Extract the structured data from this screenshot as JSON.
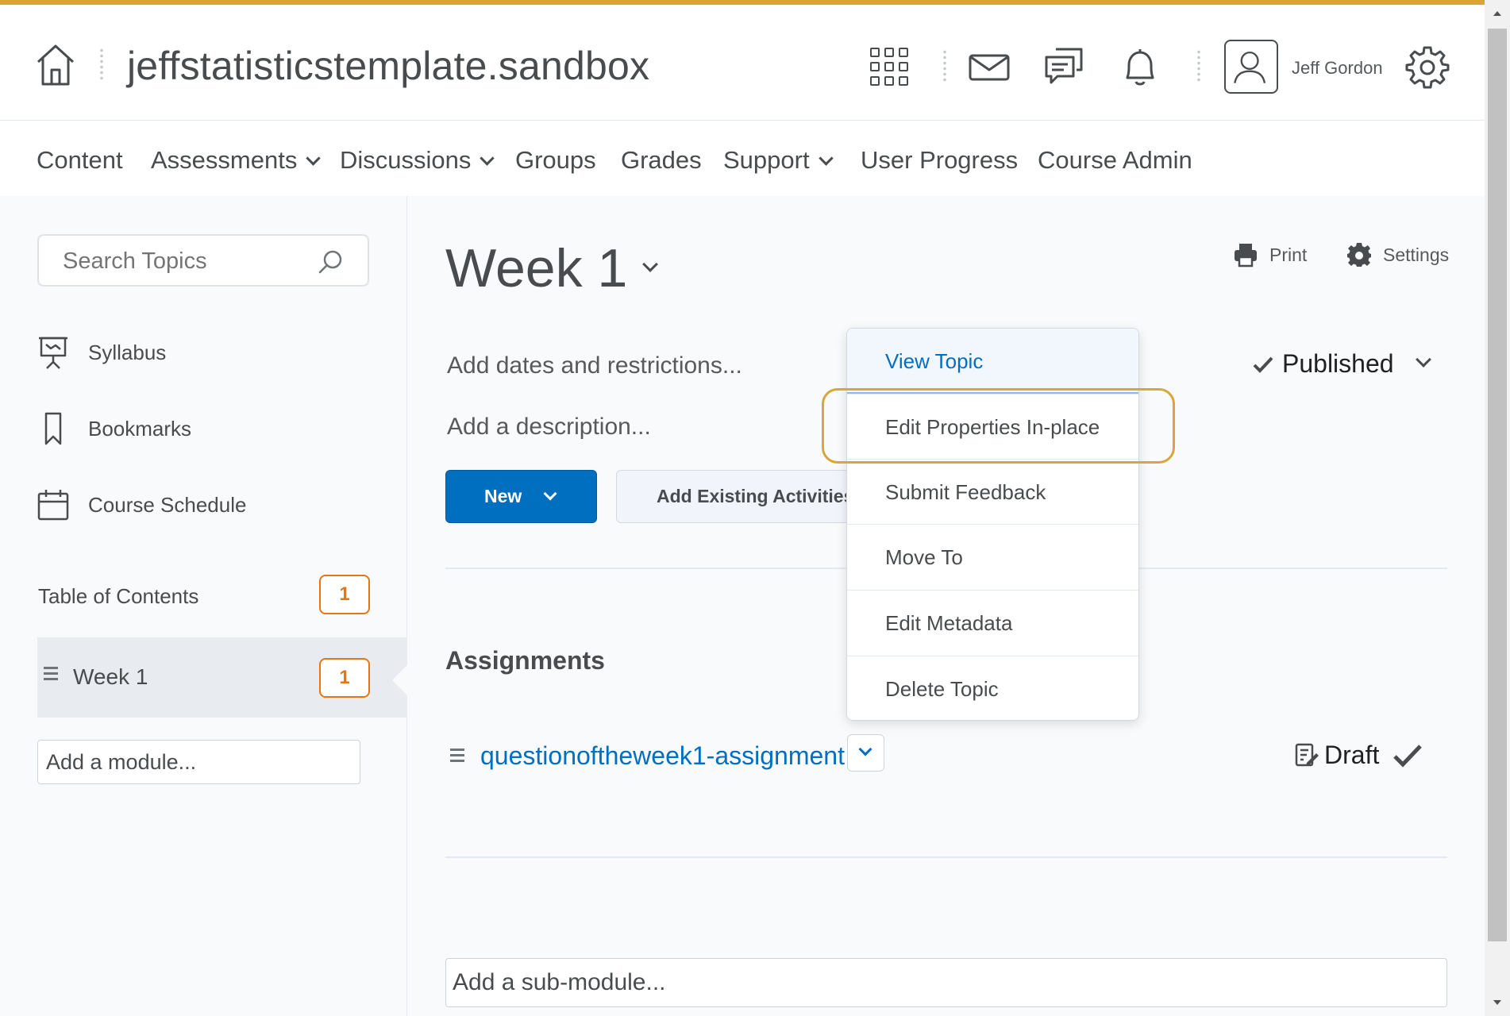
{
  "header": {
    "org_title": "jeffstatisticstemplate.sandbox",
    "user_name": "Jeff Gordon"
  },
  "nav": {
    "items": [
      {
        "label": "Content",
        "dropdown": false
      },
      {
        "label": "Assessments",
        "dropdown": true
      },
      {
        "label": "Discussions",
        "dropdown": true
      },
      {
        "label": "Groups",
        "dropdown": false
      },
      {
        "label": "Grades",
        "dropdown": false
      },
      {
        "label": "Support",
        "dropdown": true
      },
      {
        "label": "User Progress",
        "dropdown": false
      },
      {
        "label": "Course Admin",
        "dropdown": false
      }
    ]
  },
  "sidebar": {
    "search_placeholder": "Search Topics",
    "links": [
      {
        "label": "Syllabus",
        "icon": "presentation-board-icon"
      },
      {
        "label": "Bookmarks",
        "icon": "bookmark-icon"
      },
      {
        "label": "Course Schedule",
        "icon": "calendar-icon"
      }
    ],
    "toc_label": "Table of Contents",
    "toc_count": "1",
    "module_label": "Week 1",
    "module_count": "1",
    "add_module_placeholder": "Add a module..."
  },
  "main": {
    "title": "Week 1",
    "print_label": "Print",
    "settings_label": "Settings",
    "add_dates": "Add dates and restrictions...",
    "add_description": "Add a description...",
    "new_button": "New",
    "add_existing_button": "Add Existing Activities",
    "published_label": "Published",
    "section_title": "Assignments",
    "topic_link": "questionoftheweek1-assignment",
    "draft_label": "Draft",
    "add_submodule_placeholder": "Add a sub-module..."
  },
  "menu": {
    "items": [
      "View Topic",
      "Edit Properties In-place",
      "Submit Feedback",
      "Move To",
      "Edit Metadata",
      "Delete Topic"
    ],
    "highlighted": "Edit Properties In-place"
  },
  "colors": {
    "accent_bar": "#d5a72f",
    "primary": "#006fbf",
    "badge": "#e87511",
    "highlight_ring": "#d7a63e"
  }
}
